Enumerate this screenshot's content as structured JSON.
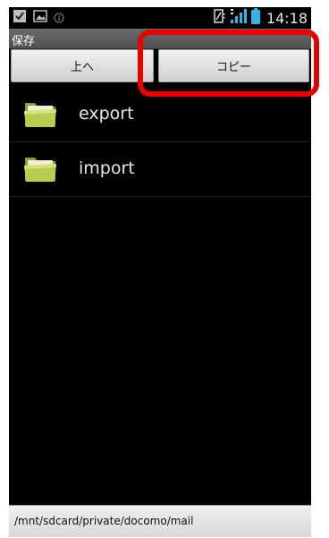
{
  "status_bar": {
    "time": "14:18",
    "icons": [
      "checkbox-icon",
      "image-icon",
      "info-icon",
      "vibrate-icon",
      "signal-icon",
      "battery-icon"
    ],
    "accent": "#33b5e5"
  },
  "title_bar": {
    "title": "保存"
  },
  "toolbar": {
    "up_label": "上へ",
    "copy_label": "コピー"
  },
  "files": [
    {
      "name": "export",
      "icon": "folder-icon"
    },
    {
      "name": "import",
      "icon": "folder-icon"
    }
  ],
  "path_bar": {
    "path": "/mnt/sdcard/private/docomo/mail"
  },
  "annotation": {
    "color": "#e60000",
    "target": "copy-button"
  }
}
